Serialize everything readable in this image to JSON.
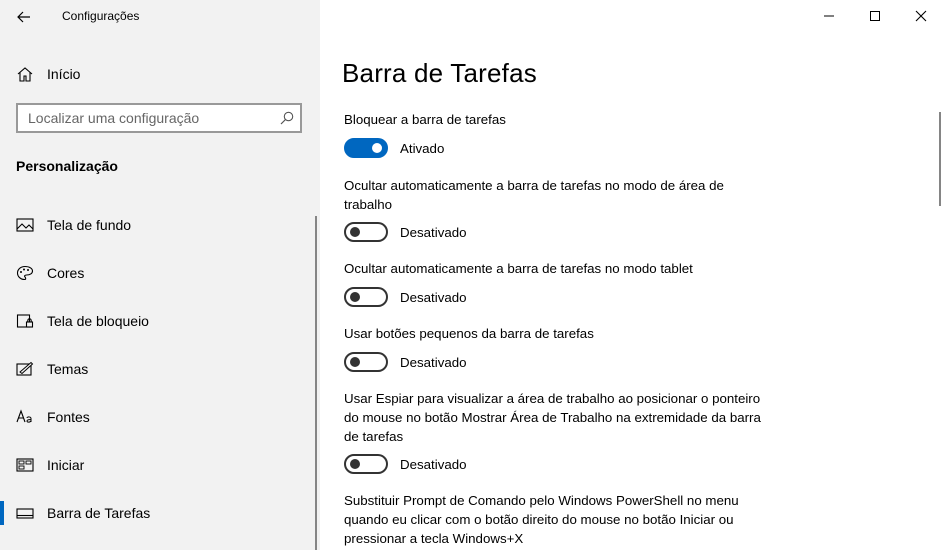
{
  "app": {
    "title": "Configurações"
  },
  "window_controls": {
    "minimize_icon": "minimize-icon",
    "maximize_icon": "maximize-icon",
    "close_icon": "close-icon"
  },
  "sidebar": {
    "home_label": "Início",
    "search": {
      "placeholder": "Localizar uma configuração",
      "value": ""
    },
    "section_title": "Personalização",
    "items": [
      {
        "label": "Tela de fundo",
        "icon": "picture-icon"
      },
      {
        "label": "Cores",
        "icon": "palette-icon"
      },
      {
        "label": "Tela de bloqueio",
        "icon": "lock-screen-icon"
      },
      {
        "label": "Temas",
        "icon": "themes-icon"
      },
      {
        "label": "Fontes",
        "icon": "fonts-icon"
      },
      {
        "label": "Iniciar",
        "icon": "start-icon"
      },
      {
        "label": "Barra de Tarefas",
        "icon": "taskbar-icon",
        "selected": true
      }
    ]
  },
  "main": {
    "page_title": "Barra de Tarefas",
    "settings": [
      {
        "line1": "Bloquear a barra de tarefas",
        "state": "Ativado",
        "on": true
      },
      {
        "line1": "Ocultar automaticamente a barra de tarefas no modo de área de",
        "line2": "trabalho",
        "state": "Desativado",
        "on": false
      },
      {
        "line1": "Ocultar automaticamente a barra de tarefas no modo tablet",
        "state": "Desativado",
        "on": false
      },
      {
        "line1": "Usar botões pequenos da barra de tarefas",
        "state": "Desativado",
        "on": false
      },
      {
        "line1": "Usar Espiar para visualizar a área de trabalho ao posicionar o ponteiro",
        "line2": "do mouse no botão Mostrar Área de Trabalho na extremidade da barra",
        "line3": "de tarefas",
        "state": "Desativado",
        "on": false
      },
      {
        "line1": "Substituir Prompt de Comando pelo Windows PowerShell no menu",
        "line2": "quando eu clicar com o botão direito do mouse no botão Iniciar ou",
        "line3": "pressionar a tecla Windows+X"
      }
    ]
  },
  "colors": {
    "accent": "#0067c0",
    "sidebar_bg": "#f2f2f2",
    "main_bg": "#ffffff"
  }
}
